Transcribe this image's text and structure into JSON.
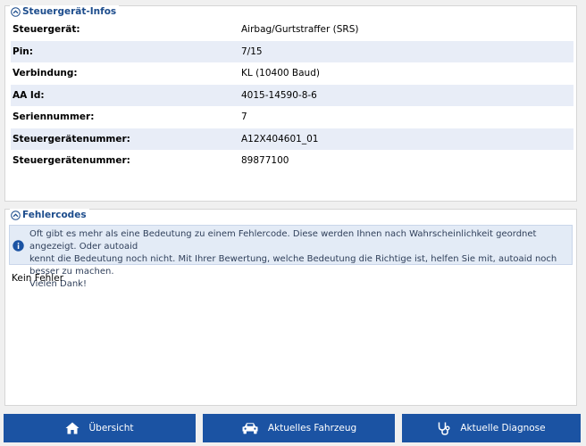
{
  "info_panel": {
    "title": "Steuergerät-Infos",
    "rows": [
      {
        "label": "Steuergerät:",
        "value": "Airbag/Gurtstraffer (SRS)"
      },
      {
        "label": "Pin:",
        "value": "7/15"
      },
      {
        "label": "Verbindung:",
        "value": "KL (10400 Baud)"
      },
      {
        "label": "AA Id:",
        "value": "4015-14590-8-6"
      },
      {
        "label": "Seriennummer:",
        "value": "7"
      },
      {
        "label": "Steuergerätenummer:",
        "value": "A12X404601_01"
      },
      {
        "label": "Steuergerätenummer:",
        "value": "89877100"
      }
    ]
  },
  "codes_panel": {
    "title": "Fehlercodes",
    "notice_line1": "Oft gibt es mehr als eine Bedeutung zu einem Fehlercode. Diese werden Ihnen nach Wahrscheinlichkeit geordnet angezeigt. Oder autoaid",
    "notice_line2": "kennt die Bedeutung noch nicht. Mit Ihrer Bewertung, welche Bedeutung die Richtige ist, helfen Sie mit, autoaid noch besser zu machen.",
    "notice_line3": "Vielen Dank!",
    "empty_text": "Kein Fehler"
  },
  "nav": {
    "overview_label": "Übersicht",
    "vehicle_label": "Aktuelles Fahrzeug",
    "diagnosis_label": "Aktuelle Diagnose"
  },
  "colors": {
    "accent": "#1b53a3",
    "title_text": "#1c4c8c",
    "row_alt": "#e8edf7",
    "notice_bg": "#e3ebf6"
  }
}
